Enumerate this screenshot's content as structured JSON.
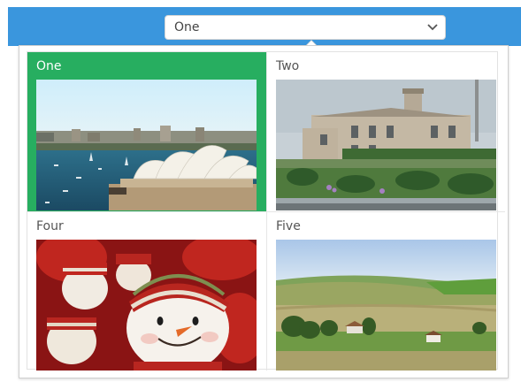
{
  "header": {
    "select": {
      "value": "One",
      "chevron_icon": "chevron-down-icon"
    }
  },
  "gallery": {
    "items": [
      {
        "label": "One",
        "selected": true,
        "image": "sydney-opera-house-photo"
      },
      {
        "label": "Two",
        "selected": false,
        "image": "stone-mansion-photo"
      },
      {
        "label": "Four",
        "selected": false,
        "image": "snowman-toys-photo"
      },
      {
        "label": "Five",
        "selected": false,
        "image": "countryside-fields-photo"
      }
    ]
  },
  "colors": {
    "topbar": "#3a96dd",
    "selected": "#27ae60"
  }
}
